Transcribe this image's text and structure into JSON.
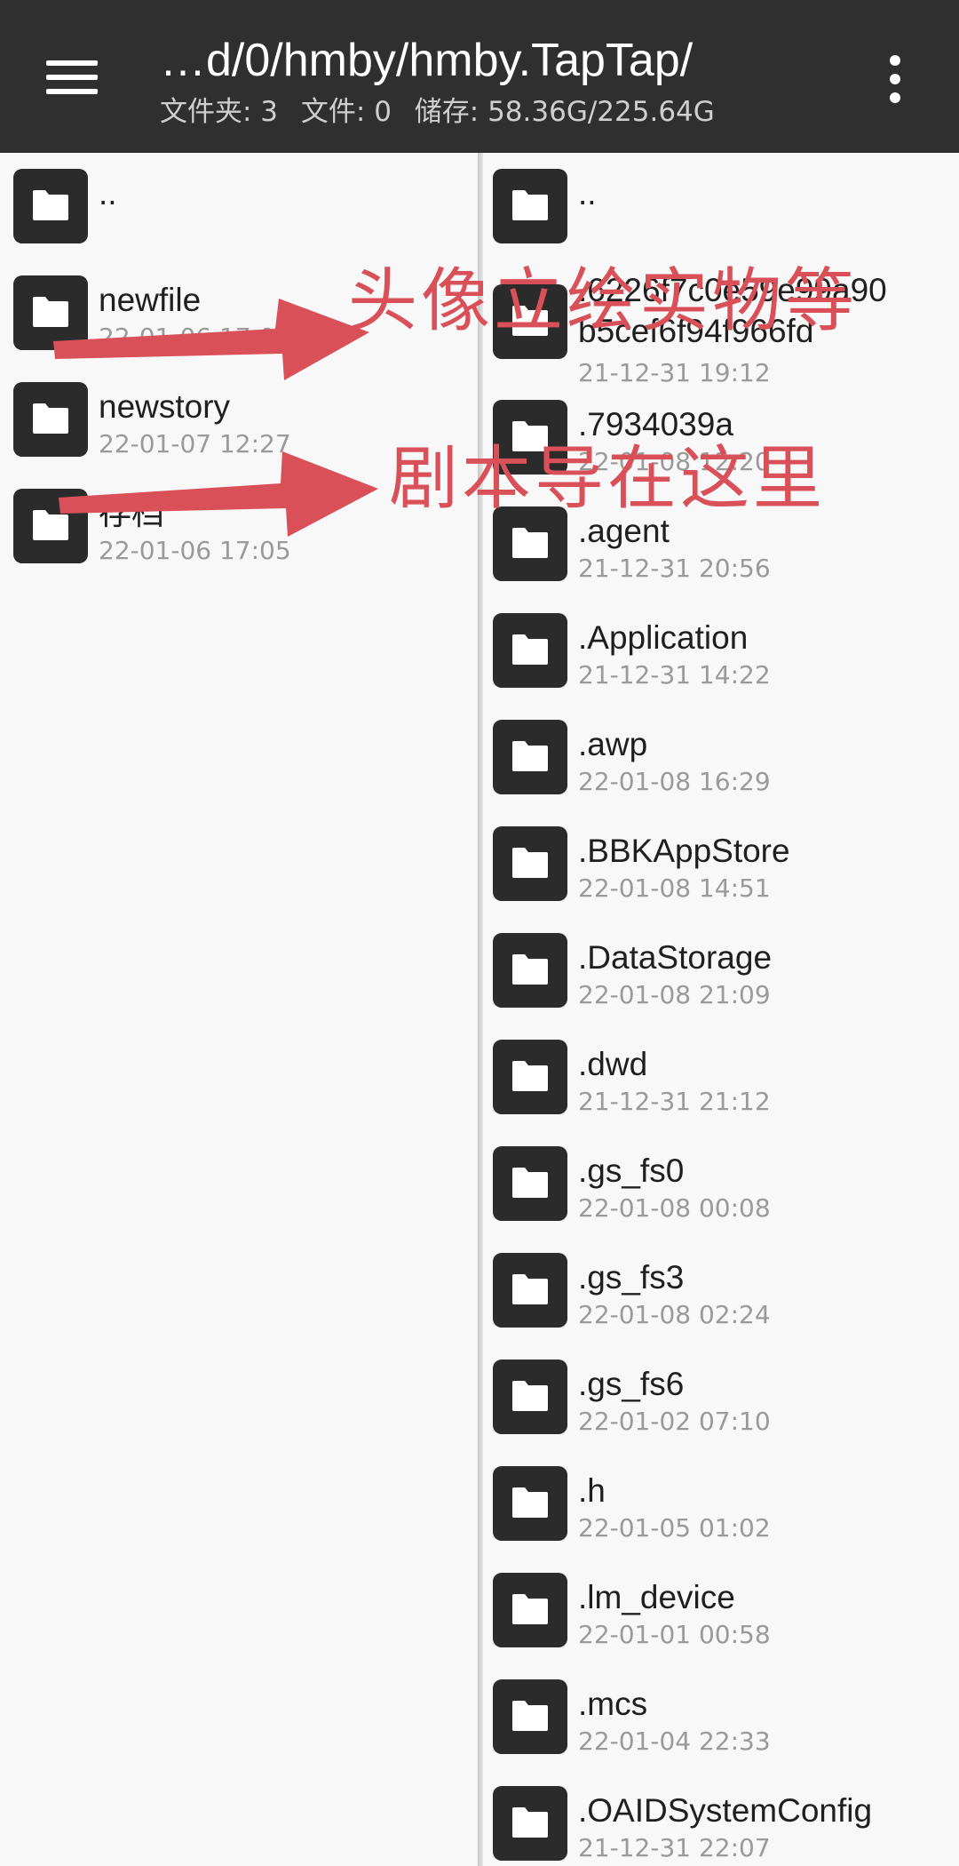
{
  "appbar": {
    "path": "…d/0/hmby/hmby.TapTap/",
    "folders_label": "文件夹: 3",
    "files_label": "文件: 0",
    "storage_label": "储存: 58.36G/225.64G"
  },
  "left_pane": {
    "items": [
      {
        "name": "..",
        "date": ""
      },
      {
        "name": "newfile",
        "date": "22-01-06 17:05"
      },
      {
        "name": "newstory",
        "date": "22-01-07 12:27"
      },
      {
        "name": "存档",
        "date": "22-01-06 17:05"
      }
    ]
  },
  "right_pane": {
    "items": [
      {
        "name": "..",
        "date": ""
      },
      {
        "name": ".6226f7c0e59e99a90b5cef6f94f966fd",
        "name_line1": ".6226f7c0e59e99a90",
        "name_line2": "b5cef6f94f966fd",
        "date": "21-12-31 19:12"
      },
      {
        "name": ".7934039a",
        "date": "22-01-08 12:20"
      },
      {
        "name": ".agent",
        "date": "21-12-31 20:56"
      },
      {
        "name": ".Application",
        "date": "21-12-31 14:22"
      },
      {
        "name": ".awp",
        "date": "22-01-08 16:29"
      },
      {
        "name": ".BBKAppStore",
        "date": "22-01-08 14:51"
      },
      {
        "name": ".DataStorage",
        "date": "22-01-08 21:09"
      },
      {
        "name": ".dwd",
        "date": "21-12-31 21:12"
      },
      {
        "name": ".gs_fs0",
        "date": "22-01-08 00:08"
      },
      {
        "name": ".gs_fs3",
        "date": "22-01-08 02:24"
      },
      {
        "name": ".gs_fs6",
        "date": "22-01-02 07:10"
      },
      {
        "name": ".h",
        "date": "22-01-05 01:02"
      },
      {
        "name": ".lm_device",
        "date": "22-01-01 00:58"
      },
      {
        "name": ".mcs",
        "date": "22-01-04 22:33"
      },
      {
        "name": ".OAIDSystemConfig",
        "date": "21-12-31 22:07"
      }
    ]
  },
  "annotations": {
    "note_1": "头像立绘实物等",
    "note_2": "剧本导在这里",
    "color": "#d95058"
  }
}
